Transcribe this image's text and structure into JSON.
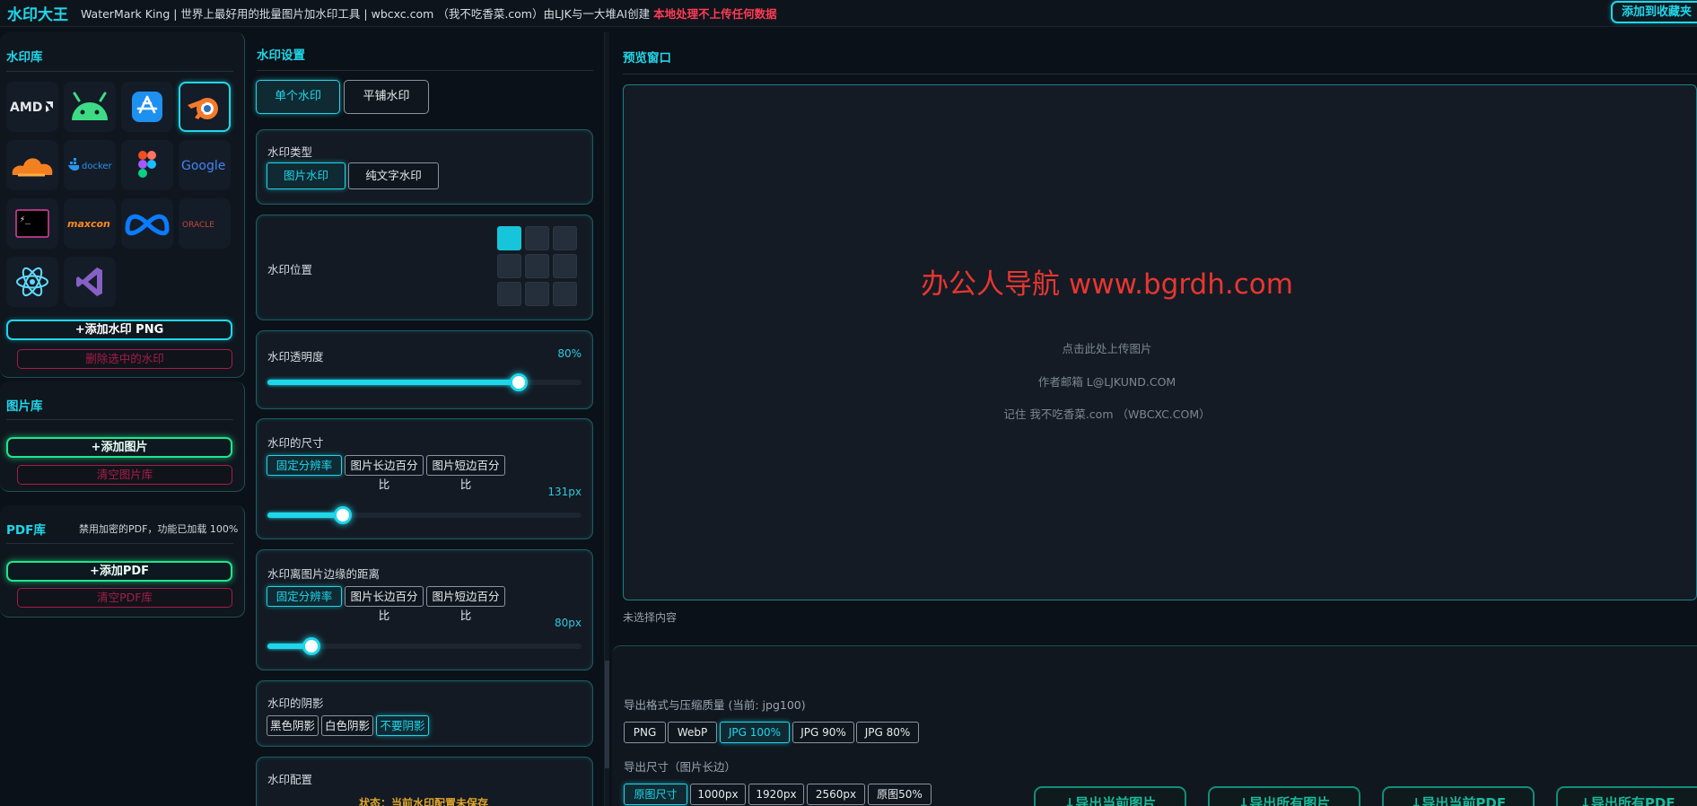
{
  "header": {
    "app_title": "水印大王",
    "tagline": "WaterMark King | 世界上最好用的批量图片加水印工具 | wbcxc.com （我不吃香菜.com）由LJK与一大堆AI创建",
    "tagline_highlight": "本地处理不上传任何数据",
    "favorite_button": "添加到收藏夹"
  },
  "watermark_library": {
    "title": "水印库",
    "icons": [
      "amd-logo-icon",
      "android-icon",
      "app-store-icon",
      "blender-icon",
      "cloudflare-icon",
      "docker-icon",
      "figma-icon",
      "google-icon",
      "terminal-icon",
      "maxcon-icon",
      "meta-icon",
      "oracle-icon",
      "react-icon",
      "visual-studio-icon"
    ],
    "icon_labels": {
      "amd": "AMD",
      "docker": "docker",
      "google": "Google",
      "maxcon": "maxcon",
      "oracle": "ORACLE"
    },
    "add_button": "+添加水印 PNG",
    "delete_button": "删除选中的水印"
  },
  "image_library": {
    "title": "图片库",
    "add_button": "+添加图片",
    "clear_button": "清空图片库"
  },
  "pdf_library": {
    "title": "PDF库",
    "note": "禁用加密的PDF，功能已加载 100%",
    "add_button": "+添加PDF",
    "clear_button": "清空PDF库"
  },
  "settings": {
    "title": "水印设置",
    "mode_tabs": [
      "单个水印",
      "平铺水印"
    ],
    "type": {
      "label": "水印类型",
      "options": [
        "图片水印",
        "纯文字水印"
      ]
    },
    "position": {
      "label": "水印位置",
      "selected_index": 0
    },
    "opacity": {
      "label": "水印透明度",
      "value_text": "80%",
      "value": 0.8
    },
    "size": {
      "label": "水印的尺寸",
      "options": [
        "固定分辨率",
        "图片长边百分比",
        "图片短边百分比"
      ],
      "value_text": "131px",
      "value": 0.24
    },
    "margin": {
      "label": "水印离图片边缘的距离",
      "options": [
        "固定分辨率",
        "图片长边百分比",
        "图片短边百分比"
      ],
      "value_text": "80px",
      "value": 0.14
    },
    "shadow": {
      "label": "水印的阴影",
      "options": [
        "黑色阴影",
        "白色阴影",
        "不要阴影"
      ]
    },
    "config": {
      "label": "水印配置",
      "status": "状态：当前水印配置未保存"
    }
  },
  "preview": {
    "title": "预览窗口",
    "watermark_text": "办公人导航 www.bgrdh.com",
    "upload_hint": "点击此处上传图片",
    "author_email": "作者邮箱 L@LJKUND.COM",
    "remember": "记住 我不吃香菜.com （WBCXC.COM）",
    "status": "未选择内容"
  },
  "export": {
    "format_label": "导出格式与压缩质量 (当前: jpg100)",
    "formats": [
      "PNG",
      "WebP",
      "JPG 100%",
      "JPG 90%",
      "JPG 80%"
    ],
    "size_label": "导出尺寸（图片长边）",
    "sizes": [
      "原图尺寸",
      "1000px",
      "1920px",
      "2560px",
      "原图50%"
    ],
    "buttons": [
      "↓导出当前图片",
      "↓导出所有图片",
      "↓导出当前PDF",
      "↓导出所有PDF"
    ]
  },
  "colors": {
    "accent": "#1fd7ea",
    "green": "#1ee68c",
    "danger": "#a81c48",
    "watermark_red": "#e8362f"
  }
}
